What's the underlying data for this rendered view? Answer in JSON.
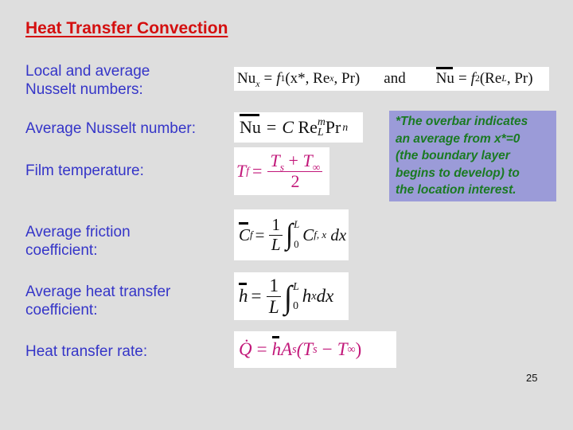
{
  "slide": {
    "title": "Heat Transfer Convection",
    "page_number": "25",
    "colors": {
      "background": "#dedede",
      "title": "#d40f0f",
      "labels": "#3535c8",
      "note_background": "#9b9bd8",
      "note_text": "#1a7a22",
      "formula_magenta": "#c2187a"
    }
  },
  "rows": [
    {
      "label": "Local and average\nNusselt numbers:",
      "formula": {
        "local_lhs": "Nu",
        "local_sub": "x",
        "local_rhs_fn": "f",
        "local_rhs_fn_sub": "1",
        "local_args": "(x*, Re",
        "local_args_sub": "x",
        "local_args_end": ", Pr)",
        "connector": "and",
        "avg_lhs": "Nu",
        "avg_rhs_fn": "f",
        "avg_rhs_fn_sub": "2",
        "avg_args": "(Re",
        "avg_args_sub": "L",
        "avg_args_end": ", Pr)"
      }
    },
    {
      "label": "Average Nusselt number:",
      "formula": {
        "lhs": "Nu",
        "const": "C",
        "re": "Re",
        "re_sup": "m",
        "re_sub": "L",
        "pr": "Pr",
        "pr_sup": "n"
      }
    },
    {
      "label": "Film temperature:",
      "formula": {
        "lhs": "T",
        "lhs_sub": "f",
        "num_a": "T",
        "num_a_sub": "s",
        "num_op": "+",
        "num_b": "T",
        "num_b_sub": "∞",
        "den": "2"
      }
    },
    {
      "label": "Average friction\ncoefficient:",
      "formula": {
        "lhs": "C",
        "lhs_sub": "f",
        "frac_num": "1",
        "frac_den": "L",
        "upper": "L",
        "lower": "0",
        "integrand": "C",
        "integrand_sub": "f, x",
        "diff": "dx"
      }
    },
    {
      "label": "Average heat transfer\ncoefficient:",
      "formula": {
        "lhs": "h",
        "frac_num": "1",
        "frac_den": "L",
        "upper": "L",
        "lower": "0",
        "integrand": "h",
        "integrand_sub": "x",
        "diff": "dx"
      }
    },
    {
      "label": "Heat transfer rate:",
      "formula": {
        "lhs": "Q̇",
        "h": "h",
        "area": "A",
        "area_sub": "s",
        "paren_open": "(T",
        "ts_sub": "s",
        "minus": "−",
        "tinf": "T",
        "tinf_sub": "∞",
        "paren_close": ")"
      }
    }
  ],
  "note": {
    "text": "*The overbar indicates\nan average from x*=0\n(the boundary layer\nbegins to develop) to\nthe location interest."
  }
}
